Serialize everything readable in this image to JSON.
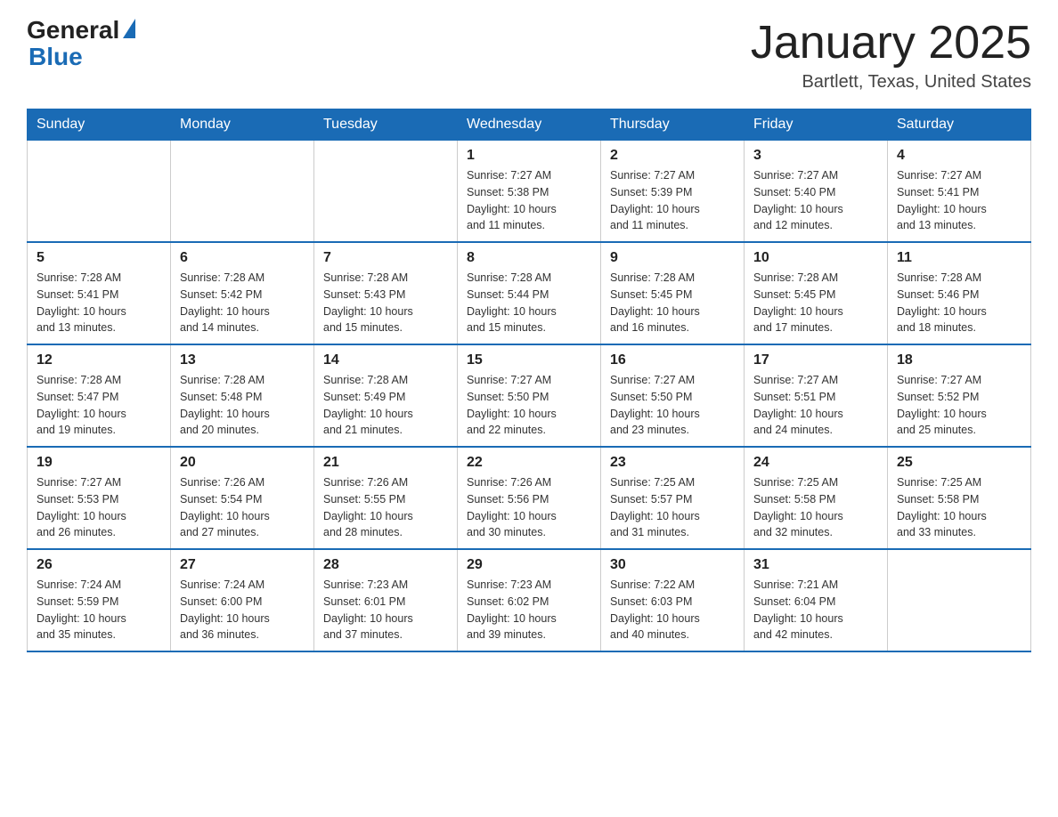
{
  "header": {
    "logo_general": "General",
    "logo_blue": "Blue",
    "month_title": "January 2025",
    "location": "Bartlett, Texas, United States"
  },
  "weekdays": [
    "Sunday",
    "Monday",
    "Tuesday",
    "Wednesday",
    "Thursday",
    "Friday",
    "Saturday"
  ],
  "weeks": [
    [
      {
        "day": "",
        "info": ""
      },
      {
        "day": "",
        "info": ""
      },
      {
        "day": "",
        "info": ""
      },
      {
        "day": "1",
        "info": "Sunrise: 7:27 AM\nSunset: 5:38 PM\nDaylight: 10 hours\nand 11 minutes."
      },
      {
        "day": "2",
        "info": "Sunrise: 7:27 AM\nSunset: 5:39 PM\nDaylight: 10 hours\nand 11 minutes."
      },
      {
        "day": "3",
        "info": "Sunrise: 7:27 AM\nSunset: 5:40 PM\nDaylight: 10 hours\nand 12 minutes."
      },
      {
        "day": "4",
        "info": "Sunrise: 7:27 AM\nSunset: 5:41 PM\nDaylight: 10 hours\nand 13 minutes."
      }
    ],
    [
      {
        "day": "5",
        "info": "Sunrise: 7:28 AM\nSunset: 5:41 PM\nDaylight: 10 hours\nand 13 minutes."
      },
      {
        "day": "6",
        "info": "Sunrise: 7:28 AM\nSunset: 5:42 PM\nDaylight: 10 hours\nand 14 minutes."
      },
      {
        "day": "7",
        "info": "Sunrise: 7:28 AM\nSunset: 5:43 PM\nDaylight: 10 hours\nand 15 minutes."
      },
      {
        "day": "8",
        "info": "Sunrise: 7:28 AM\nSunset: 5:44 PM\nDaylight: 10 hours\nand 15 minutes."
      },
      {
        "day": "9",
        "info": "Sunrise: 7:28 AM\nSunset: 5:45 PM\nDaylight: 10 hours\nand 16 minutes."
      },
      {
        "day": "10",
        "info": "Sunrise: 7:28 AM\nSunset: 5:45 PM\nDaylight: 10 hours\nand 17 minutes."
      },
      {
        "day": "11",
        "info": "Sunrise: 7:28 AM\nSunset: 5:46 PM\nDaylight: 10 hours\nand 18 minutes."
      }
    ],
    [
      {
        "day": "12",
        "info": "Sunrise: 7:28 AM\nSunset: 5:47 PM\nDaylight: 10 hours\nand 19 minutes."
      },
      {
        "day": "13",
        "info": "Sunrise: 7:28 AM\nSunset: 5:48 PM\nDaylight: 10 hours\nand 20 minutes."
      },
      {
        "day": "14",
        "info": "Sunrise: 7:28 AM\nSunset: 5:49 PM\nDaylight: 10 hours\nand 21 minutes."
      },
      {
        "day": "15",
        "info": "Sunrise: 7:27 AM\nSunset: 5:50 PM\nDaylight: 10 hours\nand 22 minutes."
      },
      {
        "day": "16",
        "info": "Sunrise: 7:27 AM\nSunset: 5:50 PM\nDaylight: 10 hours\nand 23 minutes."
      },
      {
        "day": "17",
        "info": "Sunrise: 7:27 AM\nSunset: 5:51 PM\nDaylight: 10 hours\nand 24 minutes."
      },
      {
        "day": "18",
        "info": "Sunrise: 7:27 AM\nSunset: 5:52 PM\nDaylight: 10 hours\nand 25 minutes."
      }
    ],
    [
      {
        "day": "19",
        "info": "Sunrise: 7:27 AM\nSunset: 5:53 PM\nDaylight: 10 hours\nand 26 minutes."
      },
      {
        "day": "20",
        "info": "Sunrise: 7:26 AM\nSunset: 5:54 PM\nDaylight: 10 hours\nand 27 minutes."
      },
      {
        "day": "21",
        "info": "Sunrise: 7:26 AM\nSunset: 5:55 PM\nDaylight: 10 hours\nand 28 minutes."
      },
      {
        "day": "22",
        "info": "Sunrise: 7:26 AM\nSunset: 5:56 PM\nDaylight: 10 hours\nand 30 minutes."
      },
      {
        "day": "23",
        "info": "Sunrise: 7:25 AM\nSunset: 5:57 PM\nDaylight: 10 hours\nand 31 minutes."
      },
      {
        "day": "24",
        "info": "Sunrise: 7:25 AM\nSunset: 5:58 PM\nDaylight: 10 hours\nand 32 minutes."
      },
      {
        "day": "25",
        "info": "Sunrise: 7:25 AM\nSunset: 5:58 PM\nDaylight: 10 hours\nand 33 minutes."
      }
    ],
    [
      {
        "day": "26",
        "info": "Sunrise: 7:24 AM\nSunset: 5:59 PM\nDaylight: 10 hours\nand 35 minutes."
      },
      {
        "day": "27",
        "info": "Sunrise: 7:24 AM\nSunset: 6:00 PM\nDaylight: 10 hours\nand 36 minutes."
      },
      {
        "day": "28",
        "info": "Sunrise: 7:23 AM\nSunset: 6:01 PM\nDaylight: 10 hours\nand 37 minutes."
      },
      {
        "day": "29",
        "info": "Sunrise: 7:23 AM\nSunset: 6:02 PM\nDaylight: 10 hours\nand 39 minutes."
      },
      {
        "day": "30",
        "info": "Sunrise: 7:22 AM\nSunset: 6:03 PM\nDaylight: 10 hours\nand 40 minutes."
      },
      {
        "day": "31",
        "info": "Sunrise: 7:21 AM\nSunset: 6:04 PM\nDaylight: 10 hours\nand 42 minutes."
      },
      {
        "day": "",
        "info": ""
      }
    ]
  ]
}
